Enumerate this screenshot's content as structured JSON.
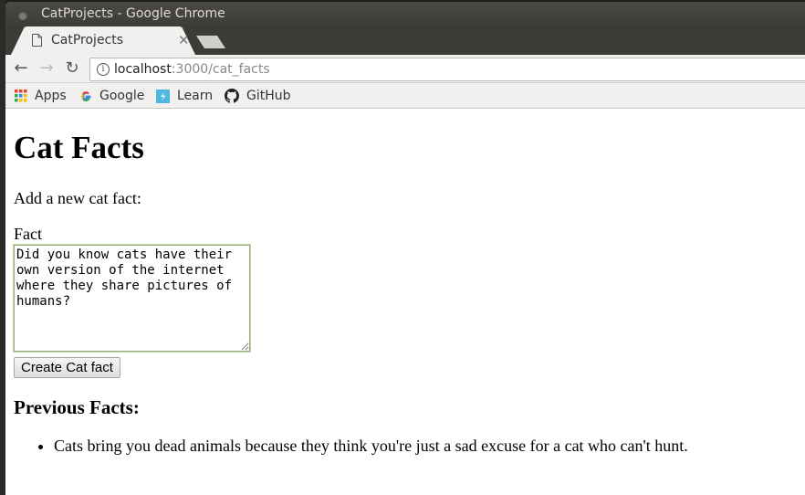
{
  "window": {
    "title": "CatProjects - Google Chrome"
  },
  "tabs": [
    {
      "label": "CatProjects",
      "active": true
    }
  ],
  "toolbar": {
    "back_icon": "arrow-left",
    "forward_icon": "arrow-right",
    "reload_icon": "reload",
    "url_host": "localhost",
    "url_rest": ":3000/cat_facts",
    "info_icon": "i"
  },
  "bookmarks": [
    {
      "label": "Apps",
      "icon": "apps-grid-icon"
    },
    {
      "label": "Google",
      "icon": "google-icon"
    },
    {
      "label": "Learn",
      "icon": "learn-icon"
    },
    {
      "label": "GitHub",
      "icon": "github-icon"
    }
  ],
  "page": {
    "heading": "Cat Facts",
    "intro": "Add a new cat fact:",
    "form": {
      "fact_label": "Fact",
      "fact_value": "Did you know cats have their own version of the internet where they share pictures of humans?",
      "submit_label": "Create Cat fact"
    },
    "previous_heading": "Previous Facts:",
    "facts": [
      "Cats bring you dead animals because they think you're just a sad excuse for a cat who can't hunt."
    ]
  },
  "colors": {
    "titlebar": "#3c3b37",
    "toolbar": "#f1f0ee",
    "textarea_border": "#9aae80"
  }
}
